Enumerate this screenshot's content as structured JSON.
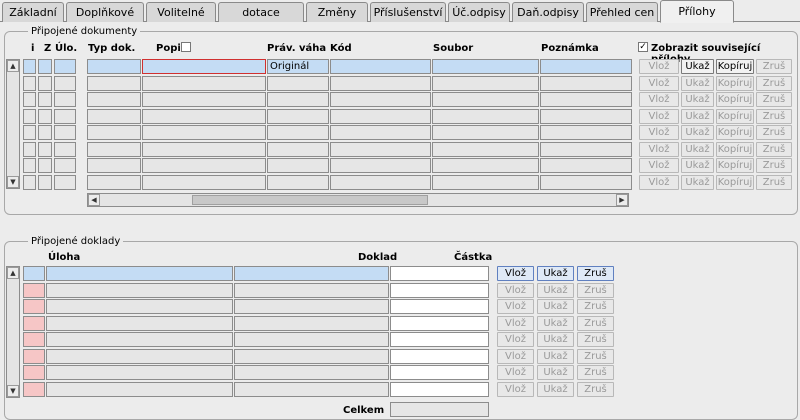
{
  "tabs": [
    "Základní",
    "Doplňkové",
    "Volitelné",
    "dotace",
    "Změny",
    "Příslušenství",
    "Úč.odpisy",
    "Daň.odpisy",
    "Přehled cen",
    "Přílohy"
  ],
  "active_tab": "Přílohy",
  "documents": {
    "title": "Připojené dokumenty",
    "headers": {
      "i": "i",
      "z": "Z",
      "ulo": "Úlo.",
      "typ": "Typ dok.",
      "popis": "Popis",
      "prav": "Práv. váha",
      "kod": "Kód",
      "soubor": "Soubor",
      "poznamka": "Poznámka"
    },
    "show_related_label": "Zobrazit související přílohy",
    "show_related_checked": "✓",
    "row1_prav": "Originál",
    "buttons": {
      "vloz": "Vlož",
      "ukaz": "Ukaž",
      "kopiruj": "Kopíruj",
      "zrus": "Zruš"
    }
  },
  "receipts": {
    "title": "Připojené doklady",
    "headers": {
      "uloha": "Úloha",
      "doklad": "Doklad",
      "castka": "Částka"
    },
    "total_label": "Celkem",
    "buttons": {
      "vloz": "Vlož",
      "ukaz": "Ukaž",
      "zrus": "Zruš"
    }
  }
}
